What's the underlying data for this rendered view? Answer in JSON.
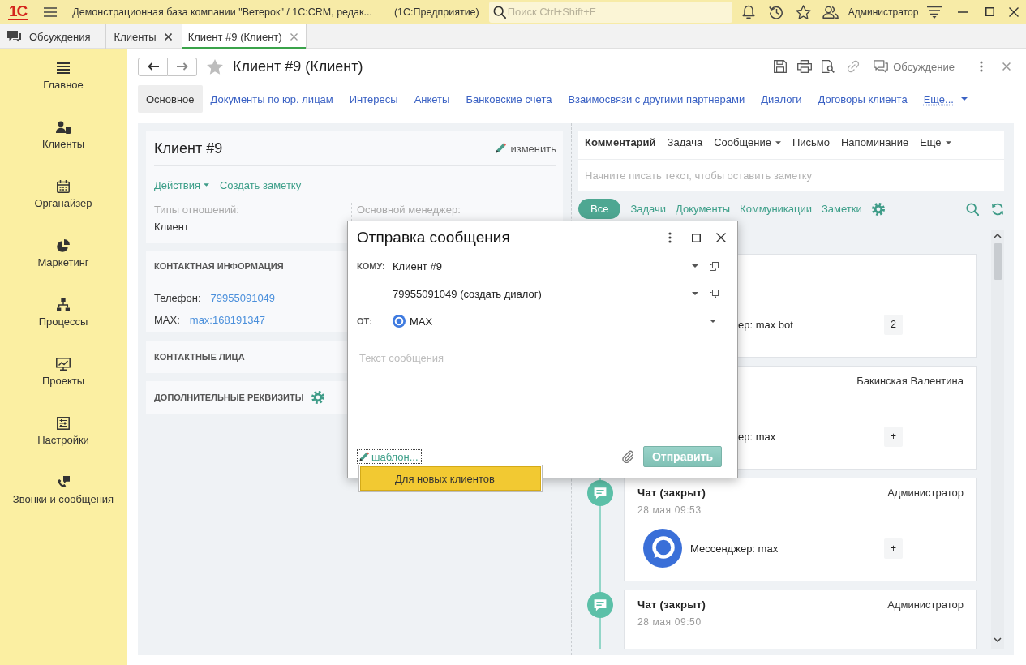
{
  "window": {
    "logo": "1С",
    "title": "Демонстрационная база компании \"Ветерок\" / 1С:CRM, редак...",
    "app_name": "(1С:Предприятие)",
    "search": {
      "placeholder": "Поиск Ctrl+Shift+F"
    },
    "user": "Администратор"
  },
  "open_tabs": [
    {
      "label": "Обсуждения",
      "kind": "discussions",
      "selected": false
    },
    {
      "label": "Клиенты",
      "kind": "page",
      "selected": false
    },
    {
      "label": "Клиент #9 (Клиент)",
      "kind": "page",
      "selected": true
    }
  ],
  "sidebar": {
    "items": [
      {
        "label": "Главное",
        "selected": false
      },
      {
        "label": "Клиенты",
        "selected": false
      },
      {
        "label": "Органайзер",
        "selected": false
      },
      {
        "label": "Маркетинг",
        "selected": false
      },
      {
        "label": "Процессы",
        "selected": false
      },
      {
        "label": "Проекты",
        "selected": false
      },
      {
        "label": "Настройки",
        "selected": false
      },
      {
        "label": "Звонки и сообщения",
        "selected": false
      }
    ]
  },
  "form": {
    "title": "Клиент #9 (Клиент)",
    "favorite": false,
    "discussion_button": "Обсуждение",
    "tabs": [
      {
        "label": "Основное",
        "selected": true
      },
      {
        "label": "Документы по юр. лицам",
        "selected": false
      },
      {
        "label": "Интересы",
        "selected": false
      },
      {
        "label": "Анкеты",
        "selected": false
      },
      {
        "label": "Банковские счета",
        "selected": false
      },
      {
        "label": "Взаимосвязи с другими партнерами",
        "selected": false
      },
      {
        "label": "Диалоги",
        "selected": false
      },
      {
        "label": "Договоры клиента",
        "selected": false
      }
    ],
    "more_tabs": "Еще..."
  },
  "client_card": {
    "title": "Клиент #9",
    "edit_link": "изменить",
    "actions": [
      {
        "label": "Действия",
        "dropdown": true
      },
      {
        "label": "Создать заметку",
        "dropdown": false
      }
    ],
    "fields": [
      {
        "label": "Типы отношений:",
        "value": "Клиент"
      },
      {
        "label": "Основной менеджер:"
      }
    ]
  },
  "sections": [
    {
      "title": "КОНТАКТНАЯ ИНФОРМАЦИЯ",
      "kind": "plain",
      "rows": [
        {
          "label": "Телефон:",
          "value": "79955091049"
        },
        {
          "label": "MAX:",
          "value": "max:168191347"
        }
      ]
    },
    {
      "title": "КОНТАКТНЫЕ ЛИЦА",
      "kind": "plain"
    },
    {
      "title": "ДОПОЛНИТЕЛЬНЫЕ РЕКВИЗИТЫ",
      "kind": "settings"
    }
  ],
  "feed": {
    "compose_tabs": [
      {
        "label": "Комментарий",
        "selected": true,
        "dropdown": false
      },
      {
        "label": "Задача",
        "selected": false,
        "dropdown": false
      },
      {
        "label": "Сообщение",
        "selected": false,
        "dropdown": true
      },
      {
        "label": "Письмо",
        "selected": false,
        "dropdown": false
      },
      {
        "label": "Напоминание",
        "selected": false,
        "dropdown": false
      },
      {
        "label": "Еще",
        "selected": false,
        "dropdown": true
      }
    ],
    "compose_placeholder": "Начните писать текст, чтобы оставить заметку",
    "filters": [
      {
        "label": "Все",
        "selected": true
      },
      {
        "label": "Задачи",
        "selected": false
      },
      {
        "label": "Документы",
        "selected": false
      },
      {
        "label": "Коммуникации",
        "selected": false
      },
      {
        "label": "Заметки",
        "selected": false
      }
    ],
    "timeline": [
      {
        "kind": "covered",
        "text": "ер: max bot",
        "badge": "2"
      },
      {
        "kind": "covered",
        "author": "Бакинская Валентина",
        "text": "ер: max",
        "badge": "+"
      },
      {
        "kind": "chat",
        "title": "Чат (закрыт)",
        "author": "Администратор",
        "date": "28 мая 09:53",
        "text": "Мессенджер: max",
        "badge": "+"
      },
      {
        "kind": "chat",
        "title": "Чат (закрыт)",
        "author": "Администратор",
        "date": "28 мая 09:50"
      }
    ]
  },
  "dialog": {
    "title": "Отправка сообщения",
    "to_label": "КОМУ:",
    "recipient": "Клиент #9",
    "address": "79955091049 (создать диалог)",
    "from_label": "ОТ:",
    "sender": "MAX",
    "message_placeholder": "Текст сообщения",
    "template_link": "шаблон...",
    "send_button": "Отправить",
    "template_menu": [
      {
        "label": "Для новых клиентов",
        "selected": true
      }
    ]
  }
}
